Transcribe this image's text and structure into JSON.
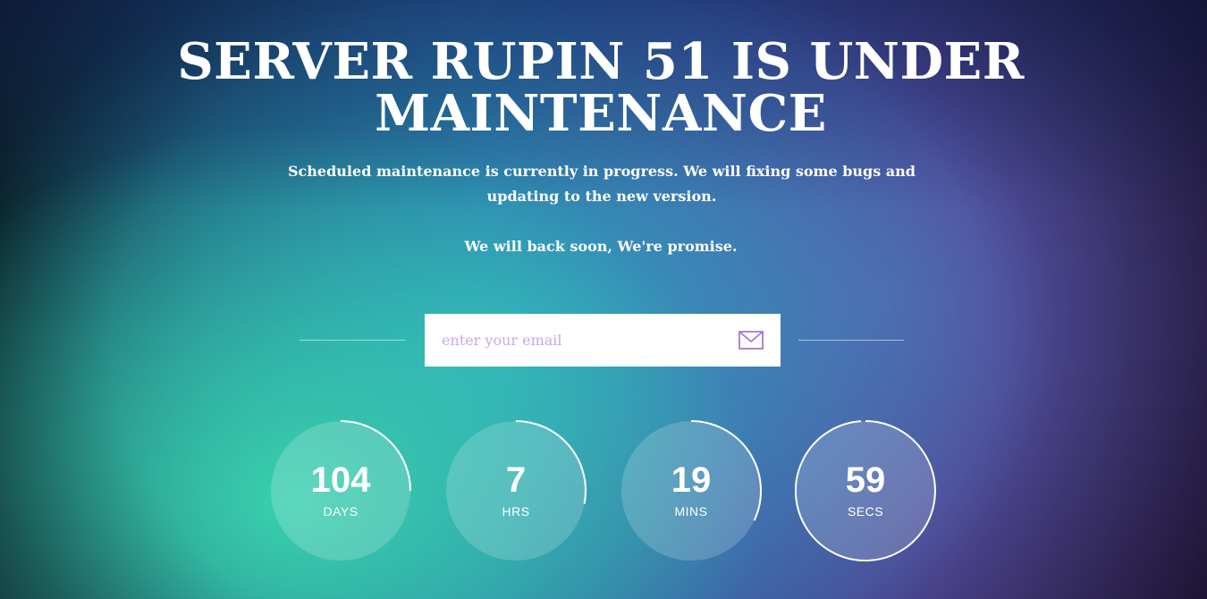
{
  "page": {
    "title": "SERVER RUPIN 51 IS UNDER MAINTENANCE",
    "description": "Scheduled maintenance is currently in progress. We will fixing some bugs and updating to the new version.",
    "promise": "We will back soon, We're promise."
  },
  "subscribe": {
    "email_placeholder": "enter your email",
    "email_value": "",
    "send_icon": "envelope-icon"
  },
  "countdown": [
    {
      "value": "104",
      "label": "DAYS",
      "progress": 0.25
    },
    {
      "value": "7",
      "label": "HRS",
      "progress": 0.28
    },
    {
      "value": "19",
      "label": "MINS",
      "progress": 0.32
    },
    {
      "value": "59",
      "label": "SECS",
      "progress": 0.99
    }
  ],
  "colors": {
    "accent": "#8d62c8",
    "circle_fill": "rgba(255,255,255,0.18)",
    "ring": "#ffffff"
  }
}
